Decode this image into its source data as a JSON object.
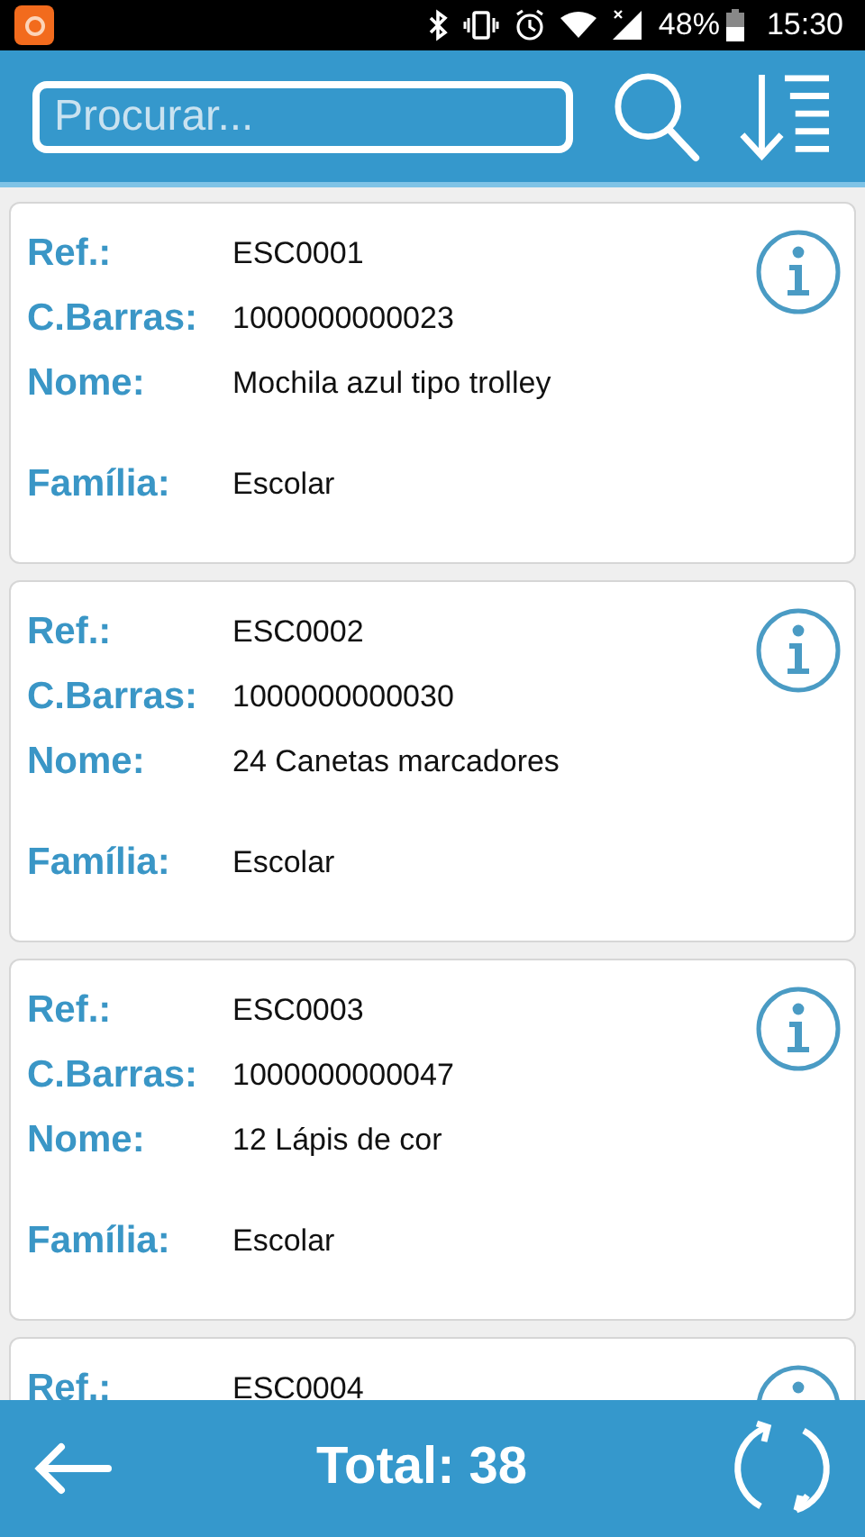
{
  "status_bar": {
    "battery": "48%",
    "time": "15:30"
  },
  "search": {
    "placeholder": "Procurar..."
  },
  "products": [
    {
      "fields": [
        {
          "label": "Ref.:",
          "value": "ESC0001"
        },
        {
          "label": "C.Barras:",
          "value": "1000000000023"
        },
        {
          "label": "Nome:",
          "value": "Mochila azul tipo trolley"
        },
        {
          "label": "Família:",
          "value": "Escolar",
          "kind": "spaced"
        }
      ]
    },
    {
      "fields": [
        {
          "label": "Ref.:",
          "value": "ESC0002"
        },
        {
          "label": "C.Barras:",
          "value": "1000000000030"
        },
        {
          "label": "Nome:",
          "value": "24 Canetas marcadores"
        },
        {
          "label": "Família:",
          "value": "Escolar",
          "kind": "spaced"
        }
      ]
    },
    {
      "fields": [
        {
          "label": "Ref.:",
          "value": "ESC0003"
        },
        {
          "label": "C.Barras:",
          "value": "1000000000047"
        },
        {
          "label": "Nome:",
          "value": "12 Lápis de cor"
        },
        {
          "label": "Família:",
          "value": "Escolar",
          "kind": "spaced"
        }
      ]
    },
    {
      "fields": [
        {
          "label": "Ref.:",
          "value": "ESC0004"
        }
      ]
    }
  ],
  "footer": {
    "total": "Total: 38"
  }
}
